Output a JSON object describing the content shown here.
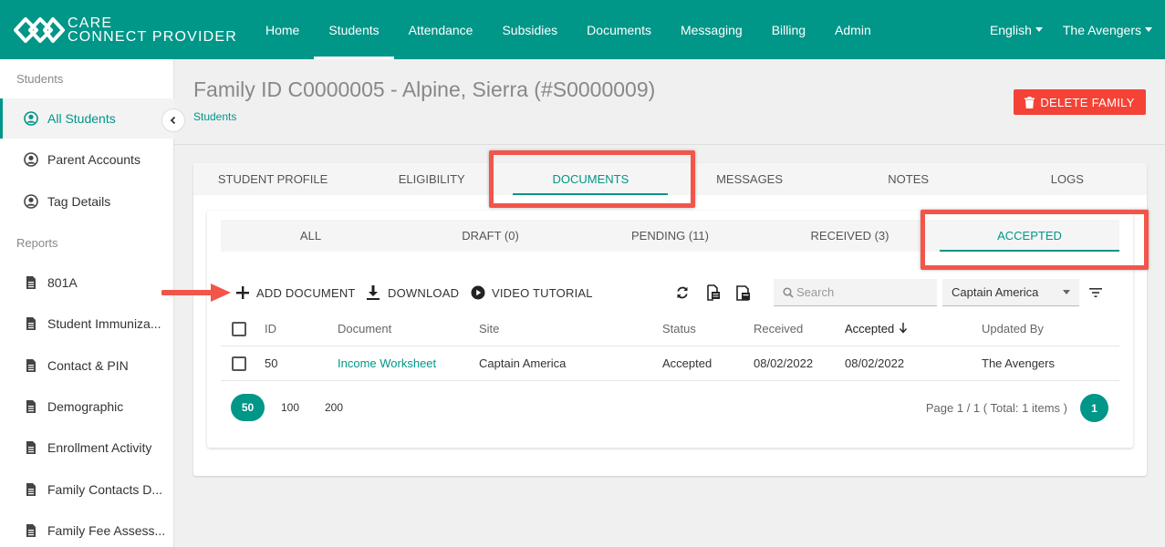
{
  "app": {
    "brand_line1": "CARE",
    "brand_line2": "CONNECT PROVIDER",
    "accent_color": "#009688",
    "danger_color": "#f44336"
  },
  "nav": {
    "items": [
      "Home",
      "Students",
      "Attendance",
      "Subsidies",
      "Documents",
      "Messaging",
      "Billing",
      "Admin"
    ],
    "active": "Students",
    "language": "English",
    "account": "The Avengers"
  },
  "sidebar": {
    "section_students": "Students",
    "students_items": [
      {
        "label": "All Students",
        "icon": "user-circle-icon"
      },
      {
        "label": "Parent Accounts",
        "icon": "user-circle-icon"
      },
      {
        "label": "Tag Details",
        "icon": "user-circle-icon"
      }
    ],
    "section_reports": "Reports",
    "report_items": [
      {
        "label": "801A",
        "icon": "document-icon"
      },
      {
        "label": "Student Immuniza...",
        "icon": "document-icon"
      },
      {
        "label": "Contact & PIN",
        "icon": "document-icon"
      },
      {
        "label": "Demographic",
        "icon": "document-icon"
      },
      {
        "label": "Enrollment Activity",
        "icon": "document-icon"
      },
      {
        "label": "Family Contacts D...",
        "icon": "document-icon"
      },
      {
        "label": "Family Fee Assess...",
        "icon": "document-icon"
      }
    ]
  },
  "header": {
    "title": "Family ID C0000005 - Alpine, Sierra (#S0000009)",
    "breadcrumb": "Students",
    "delete_label": "DELETE FAMILY"
  },
  "tabs": [
    "STUDENT PROFILE",
    "ELIGIBILITY",
    "DOCUMENTS",
    "MESSAGES",
    "NOTES",
    "LOGS"
  ],
  "active_tab": "DOCUMENTS",
  "subtabs": [
    "ALL",
    "DRAFT (0)",
    "PENDING (11)",
    "RECEIVED (3)",
    "ACCEPTED"
  ],
  "active_subtab": "ACCEPTED",
  "toolbar": {
    "add_label": "ADD DOCUMENT",
    "download_label": "DOWNLOAD",
    "video_label": "VIDEO TUTORIAL",
    "search_placeholder": "Search",
    "site_select": "Captain America"
  },
  "table": {
    "headers": [
      "ID",
      "Document",
      "Site",
      "Status",
      "Received",
      "Accepted",
      "Updated By"
    ],
    "sort_column": "Accepted",
    "rows": [
      {
        "id": "50",
        "document": "Income Worksheet",
        "site": "Captain America",
        "status": "Accepted",
        "received": "08/02/2022",
        "accepted": "08/02/2022",
        "updated_by": "The Avengers"
      }
    ]
  },
  "pager": {
    "sizes": [
      "50",
      "100",
      "200"
    ],
    "active_size": "50",
    "info": "Page 1 / 1 ( Total: 1 items )",
    "current_page": "1"
  }
}
